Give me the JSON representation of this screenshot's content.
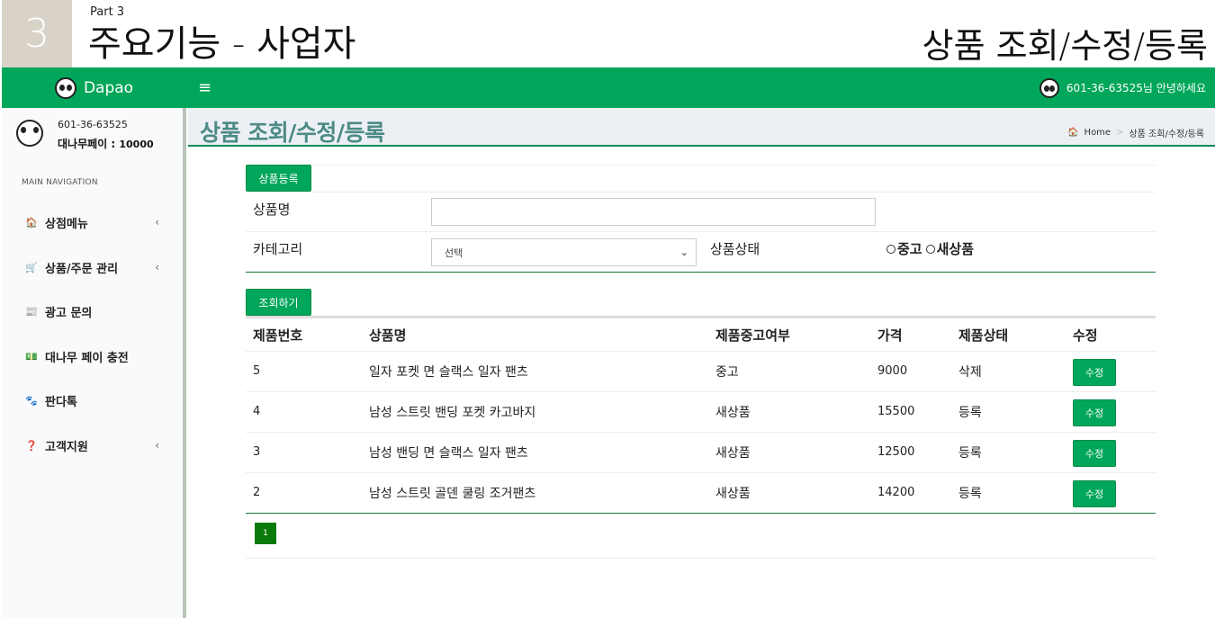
{
  "slide": {
    "number": "3",
    "part": "Part 3",
    "title": "주요기능 - 사업자",
    "right_title": "상품 조회/수정/등록"
  },
  "navbar": {
    "brand": "Dapao",
    "menu_icon": "hamburger-icon",
    "user_greeting": "601-36-63525님 안녕하세요"
  },
  "sidebar": {
    "user_id": "601-36-63525",
    "pay_label": "대나무페이 : ",
    "pay_value": "10000",
    "nav_header": "MAIN NAVIGATION",
    "items": [
      {
        "label": "상점메뉴",
        "icon": "home-icon",
        "glyph": "🏠",
        "has_caret": true
      },
      {
        "label": "상품/주문 관리",
        "icon": "cart-icon",
        "glyph": "🛒",
        "has_caret": true
      },
      {
        "label": "광고 문의",
        "icon": "newspaper-icon",
        "glyph": "📰",
        "has_caret": false
      },
      {
        "label": "대나무 페이 충전",
        "icon": "money-icon",
        "glyph": "💵",
        "has_caret": false
      },
      {
        "label": "판다톡",
        "icon": "paw-icon",
        "glyph": "🐾",
        "has_caret": false
      },
      {
        "label": "고객지원",
        "icon": "question-icon",
        "glyph": "❓",
        "has_caret": true
      }
    ]
  },
  "content_header": {
    "title": "상품 조회/수정/등록",
    "breadcrumb_home": "Home",
    "breadcrumb_current": "상품 조회/수정/등록"
  },
  "form": {
    "register_button": "상품등록",
    "product_name_label": "상품명",
    "product_name_value": "",
    "category_label": "카테고리",
    "category_selected": "선택",
    "status_label": "상품상태",
    "status_options": [
      "중고",
      "새상품"
    ],
    "search_button": "조회하기"
  },
  "table": {
    "headers": [
      "제품번호",
      "상품명",
      "제품중고여부",
      "가격",
      "제품상태",
      "수정"
    ],
    "rows": [
      {
        "id": "5",
        "name": "일자 포켓 면 슬랙스 일자 팬츠",
        "condition": "중고",
        "price": "9000",
        "state": "삭제",
        "edit": "수정"
      },
      {
        "id": "4",
        "name": "남성 스트릿 밴딩 포켓 카고바지",
        "condition": "새상품",
        "price": "15500",
        "state": "등록",
        "edit": "수정"
      },
      {
        "id": "3",
        "name": "남성 밴딩 면 슬랙스 일자 팬츠",
        "condition": "새상품",
        "price": "12500",
        "state": "등록",
        "edit": "수정"
      },
      {
        "id": "2",
        "name": "남성 스트릿 골덴 쿨링 조거팬츠",
        "condition": "새상품",
        "price": "14200",
        "state": "등록",
        "edit": "수정"
      }
    ]
  },
  "pagination": {
    "current_page": "1"
  }
}
